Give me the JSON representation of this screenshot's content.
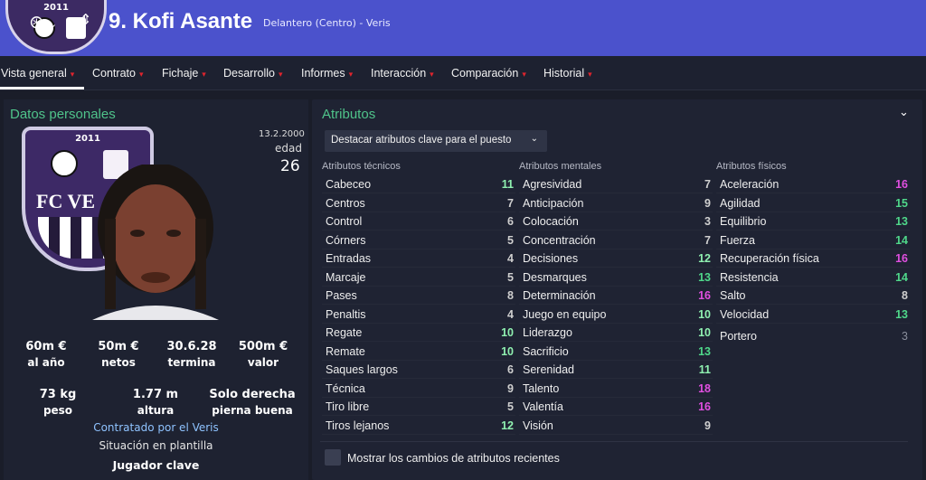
{
  "header": {
    "badge_year": "2011",
    "player_name": "9. Kofi Asante",
    "role": "Delantero (Centro) - Veris",
    "accent": "#4b52cc"
  },
  "nav": {
    "tabs": [
      {
        "label": "Vista general"
      },
      {
        "label": "Contrato"
      },
      {
        "label": "Fichaje"
      },
      {
        "label": "Desarrollo"
      },
      {
        "label": "Informes"
      },
      {
        "label": "Interacción"
      },
      {
        "label": "Comparación"
      },
      {
        "label": "Historial"
      }
    ]
  },
  "personal": {
    "title": "Datos personales",
    "badge_year": "2011",
    "badge_text": "FC VE",
    "dob": "13.2.2000",
    "age_label": "edad",
    "age": "26",
    "stats_row1": [
      {
        "value": "60m €",
        "label": "al año"
      },
      {
        "value": "50m €",
        "label": "netos"
      },
      {
        "value": "30.6.28",
        "label": "termina"
      },
      {
        "value": "500m €",
        "label": "valor"
      }
    ],
    "stats_row2": [
      {
        "value": "73 kg",
        "label": "peso"
      },
      {
        "value": "1.77 m",
        "label": "altura"
      },
      {
        "value": "Solo derecha",
        "label": "pierna buena"
      }
    ],
    "contract_by": "Contratado por el Veris",
    "squad_status_label": "Situación en plantilla",
    "squad_status": "Jugador clave"
  },
  "attributes": {
    "title": "Atributos",
    "highlight_dropdown": "Destacar atributos clave para el puesto",
    "technical": {
      "title": "Atributos técnicos",
      "items": [
        {
          "name": "Cabeceo",
          "value": "11"
        },
        {
          "name": "Centros",
          "value": "7"
        },
        {
          "name": "Control",
          "value": "6"
        },
        {
          "name": "Córners",
          "value": "5"
        },
        {
          "name": "Entradas",
          "value": "4"
        },
        {
          "name": "Marcaje",
          "value": "5"
        },
        {
          "name": "Pases",
          "value": "8"
        },
        {
          "name": "Penaltis",
          "value": "4"
        },
        {
          "name": "Regate",
          "value": "10"
        },
        {
          "name": "Remate",
          "value": "10"
        },
        {
          "name": "Saques largos",
          "value": "6"
        },
        {
          "name": "Técnica",
          "value": "9"
        },
        {
          "name": "Tiro libre",
          "value": "5"
        },
        {
          "name": "Tiros lejanos",
          "value": "12"
        }
      ]
    },
    "mental": {
      "title": "Atributos mentales",
      "items": [
        {
          "name": "Agresividad",
          "value": "7"
        },
        {
          "name": "Anticipación",
          "value": "9"
        },
        {
          "name": "Colocación",
          "value": "3"
        },
        {
          "name": "Concentración",
          "value": "7"
        },
        {
          "name": "Decisiones",
          "value": "12"
        },
        {
          "name": "Desmarques",
          "value": "13"
        },
        {
          "name": "Determinación",
          "value": "16"
        },
        {
          "name": "Juego en equipo",
          "value": "10"
        },
        {
          "name": "Liderazgo",
          "value": "10"
        },
        {
          "name": "Sacrificio",
          "value": "13"
        },
        {
          "name": "Serenidad",
          "value": "11"
        },
        {
          "name": "Talento",
          "value": "18"
        },
        {
          "name": "Valentía",
          "value": "16"
        },
        {
          "name": "Visión",
          "value": "9"
        }
      ]
    },
    "physical": {
      "title": "Atributos físicos",
      "items": [
        {
          "name": "Aceleración",
          "value": "16"
        },
        {
          "name": "Agilidad",
          "value": "15"
        },
        {
          "name": "Equilibrio",
          "value": "13"
        },
        {
          "name": "Fuerza",
          "value": "14"
        },
        {
          "name": "Recuperación física",
          "value": "16"
        },
        {
          "name": "Resistencia",
          "value": "14"
        },
        {
          "name": "Salto",
          "value": "8"
        },
        {
          "name": "Velocidad",
          "value": "13"
        }
      ],
      "goalkeeper": {
        "name": "Portero",
        "value": "3"
      }
    },
    "recent_changes_label": "Mostrar los cambios de atributos recientes"
  },
  "value_colors": {
    "low": "#cfcfcf",
    "mid": "#8ff0b0",
    "good": "#4fd88a",
    "high": "#e04fe0",
    "dim": "#8a8e9c"
  }
}
